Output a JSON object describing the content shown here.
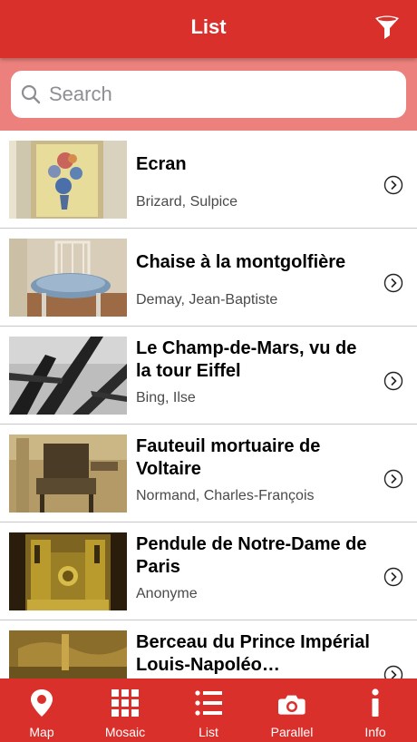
{
  "header": {
    "title": "List",
    "filter_icon": "filter-icon"
  },
  "search": {
    "placeholder": "Search",
    "value": ""
  },
  "items": [
    {
      "title": "Ecran",
      "artist": "Brizard, Sulpice"
    },
    {
      "title": "Chaise à la montgolfière",
      "artist": "Demay, Jean-Baptiste"
    },
    {
      "title": "Le Champ-de-Mars, vu de la tour Eiffel",
      "artist": "Bing, Ilse"
    },
    {
      "title": "Fauteuil mortuaire de Voltaire",
      "artist": "Normand, Charles-François"
    },
    {
      "title": "Pendule de Notre-Dame de Paris",
      "artist": "Anonyme"
    },
    {
      "title": "Berceau du Prince Impérial Louis-Napoléo…",
      "artist": ""
    }
  ],
  "tabs": [
    {
      "label": "Map",
      "icon": "map-pin-icon"
    },
    {
      "label": "Mosaic",
      "icon": "grid-icon"
    },
    {
      "label": "List",
      "icon": "list-icon"
    },
    {
      "label": "Parallel",
      "icon": "camera-icon"
    },
    {
      "label": "Info",
      "icon": "info-icon"
    }
  ],
  "colors": {
    "primary": "#d9302c",
    "search_band": "#eb807c",
    "tab_text": "#ffffff"
  }
}
